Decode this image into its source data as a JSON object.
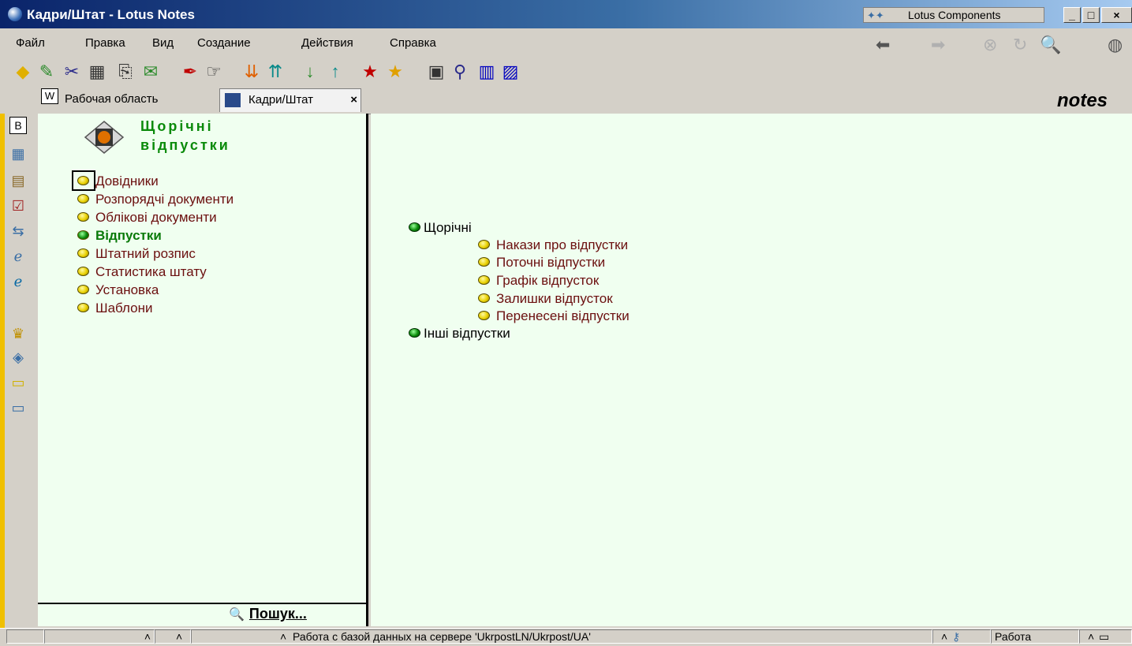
{
  "window": {
    "title": "Кадри/Штат - Lotus Notes",
    "lotus_components": "Lotus Components",
    "min_label": "_",
    "max_label": "□",
    "close_label": "×"
  },
  "menu": {
    "items": [
      "Файл",
      "Правка",
      "Вид",
      "Создание",
      "Действия",
      "Справка"
    ]
  },
  "tabs": {
    "workspace_icon": "W",
    "workspace": "Рабочая область",
    "active": "Кадри/Штат",
    "close_label": "×"
  },
  "brand": {
    "logo": "notes"
  },
  "nav": {
    "title_line1": "Щорічні",
    "title_line2": "відпустки",
    "items": [
      "Довідники",
      "Розпорядчі документи",
      "Облікові документи",
      "Відпустки",
      "Штатний розпис",
      "Статистика штату",
      "Установка",
      "Шаблони"
    ],
    "search": "Пошук..."
  },
  "view": {
    "groups": [
      {
        "label": "Щорічні",
        "children": [
          "Накази про відпустки",
          "Поточні відпустки",
          "Графік відпусток",
          "Залишки відпусток",
          "Перенесені відпустки"
        ]
      },
      {
        "label": "Інші відпустки",
        "children": []
      }
    ]
  },
  "status": {
    "message": "Работа с базой данных на сервере 'UkrpostLN/Ukrpost/UA'",
    "location": "Работа"
  },
  "colors": {
    "nav_active": "#0a7a0a",
    "item_text": "#6b0f0f",
    "pane_bg": "#f0fff0"
  }
}
